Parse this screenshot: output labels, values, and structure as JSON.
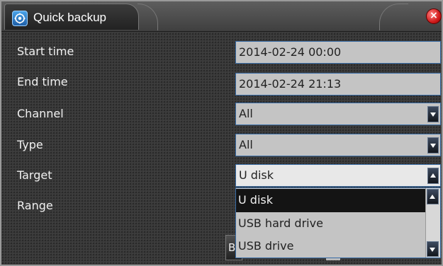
{
  "window": {
    "title": "Quick backup",
    "close_symbol": "×"
  },
  "form": {
    "start_time": {
      "label": "Start time",
      "value": "2014-02-24 00:00"
    },
    "end_time": {
      "label": "End time",
      "value": "2014-02-24 21:13"
    },
    "channel": {
      "label": "Channel",
      "value": "All"
    },
    "type": {
      "label": "Type",
      "value": "All"
    },
    "target": {
      "label": "Target",
      "value": "U disk"
    },
    "range": {
      "label": "Range"
    }
  },
  "dropdown": {
    "options": [
      "U disk",
      "USB hard drive",
      "USB drive"
    ],
    "selected": "U disk"
  },
  "partial_button": {
    "label": "B"
  },
  "icons": {
    "title": "backup-icon",
    "close": "close-icon",
    "dropdown": "chevron-down-icon",
    "scroll_up": "chevron-up-icon",
    "scroll_down": "chevron-down-icon"
  },
  "colors": {
    "field_border": "#3a6ea8",
    "selected_row": "#141414",
    "close": "#d11c1c"
  }
}
